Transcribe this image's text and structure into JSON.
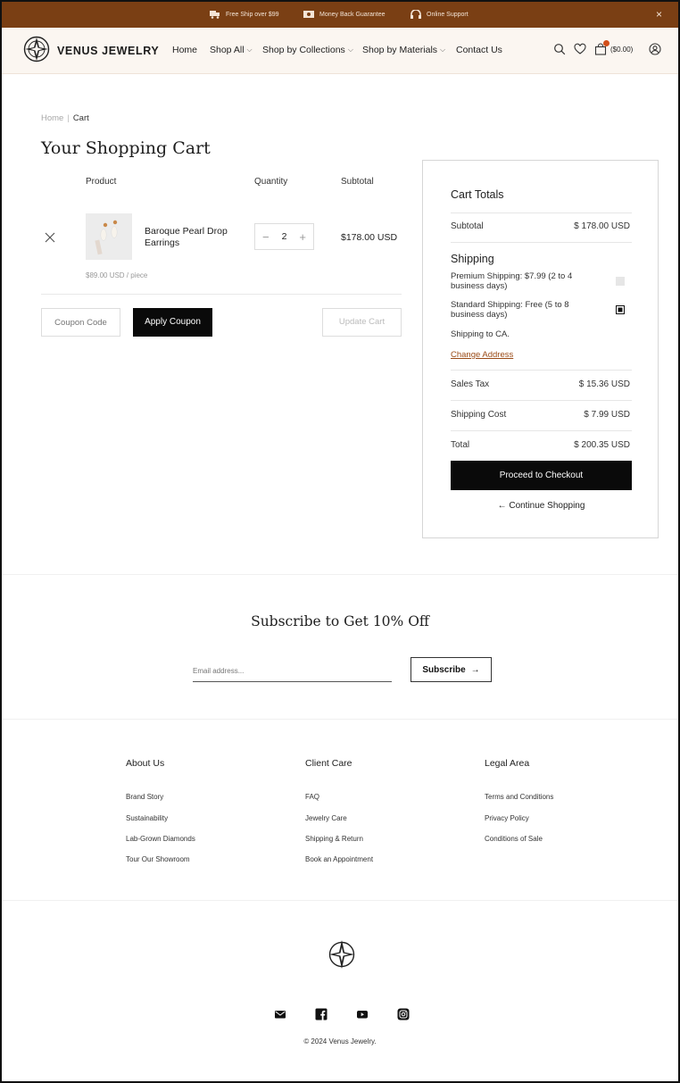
{
  "announcement": {
    "items": [
      {
        "icon": "truck-icon",
        "text": "Free Ship over $99"
      },
      {
        "icon": "cash-icon",
        "text": "Money Back Guarantee"
      },
      {
        "icon": "headset-icon",
        "text": "Online Support"
      }
    ],
    "close": "×",
    "bg_color": "#7a3f14"
  },
  "header": {
    "brand": "VENUS JEWELRY",
    "nav": [
      {
        "label": "Home",
        "caret": ""
      },
      {
        "label": "Shop All",
        "caret": "⌵"
      },
      {
        "label": "Shop by Collections",
        "caret": "⌵"
      },
      {
        "label": "Shop by Materials",
        "caret": "⌵"
      },
      {
        "label": "Contact Us",
        "caret": ""
      }
    ],
    "cart_total": "($0.00)"
  },
  "breadcrumb": {
    "home": "Home",
    "separator": "|",
    "current": "Cart"
  },
  "page_title": "Your Shopping Cart",
  "table": {
    "headers": {
      "product": "Product",
      "quantity": "Quantity",
      "subtotal": "Subtotal"
    },
    "item": {
      "name": "Baroque Pearl Drop Earrings",
      "price_each": "$89.00 USD / piece",
      "quantity": "2",
      "minus": "−",
      "plus": "+",
      "subtotal": "$178.00 USD"
    }
  },
  "coupon": {
    "placeholder": "Coupon Code",
    "apply": "Apply Coupon",
    "update": "Update Cart"
  },
  "totals": {
    "title": "Cart Totals",
    "subtotal_label": "Subtotal",
    "subtotal_value": "$ 178.00 USD",
    "shipping_title": "Shipping",
    "premium": "Premium Shipping: $7.99 (2 to 4 business days)",
    "standard": "Standard Shipping: Free (5 to 8 business days)",
    "shipping_to": "Shipping to CA.",
    "change_address": "Change Address",
    "tax_label": "Sales Tax",
    "tax_value": "$ 15.36 USD",
    "ship_cost_label": "Shipping Cost",
    "ship_cost_value": "$ 7.99 USD",
    "total_label": "Total",
    "total_value": "$ 200.35 USD",
    "checkout": "Proceed to Checkout",
    "continue": "← Continue Shopping",
    "accent_color": "#9a4a16"
  },
  "subscribe": {
    "title": "Subscribe to Get 10% Off",
    "placeholder": "Email address...",
    "button": "Subscribe",
    "arrow": "→"
  },
  "footer": {
    "columns": [
      {
        "heading": "About Us",
        "links": [
          "Brand Story",
          "Sustainability",
          "Lab-Grown Diamonds",
          "Tour Our Showroom"
        ]
      },
      {
        "heading": "Client Care",
        "links": [
          "FAQ",
          "Jewelry Care",
          "Shipping & Return",
          "Book an Appointment"
        ]
      },
      {
        "heading": "Legal Area",
        "links": [
          "Terms and Conditions",
          "Privacy Policy",
          "Conditions of Sale"
        ]
      }
    ],
    "social": [
      "email-icon",
      "facebook-icon",
      "youtube-icon",
      "instagram-icon"
    ],
    "copyright": "© 2024 Venus Jewelry."
  }
}
